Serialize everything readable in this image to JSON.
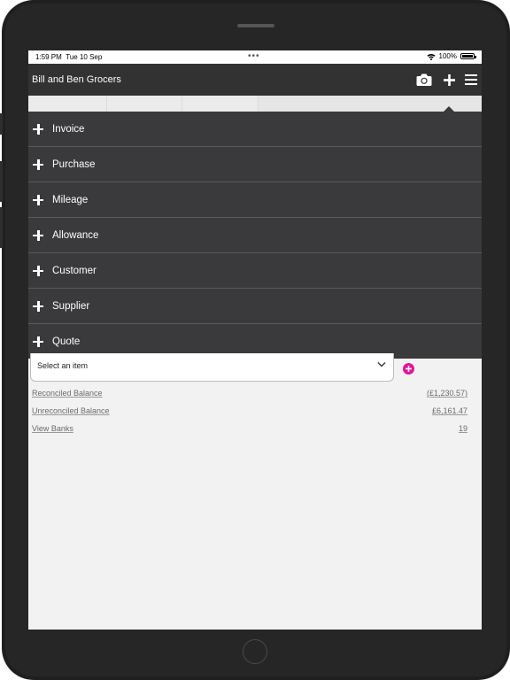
{
  "status_bar": {
    "time": "1:59 PM",
    "date": "Tue 10 Sep",
    "dots": "•••",
    "battery_text": "100%",
    "battery_level": 1.0
  },
  "app": {
    "title": "Bill and Ben Grocers",
    "icons": [
      "camera-icon",
      "plus-icon",
      "hamburger-menu-icon"
    ]
  },
  "menu": {
    "items": [
      {
        "label": "Invoice"
      },
      {
        "label": "Purchase"
      },
      {
        "label": "Mileage"
      },
      {
        "label": "Allowance"
      },
      {
        "label": "Customer"
      },
      {
        "label": "Supplier"
      },
      {
        "label": "Quote"
      }
    ]
  },
  "bank_select": {
    "value": "Select an item"
  },
  "balances": {
    "reconciled_label": "Reconciled Balance",
    "reconciled_value": "(£1,230.57)",
    "unreconciled_label": "Unreconciled Balance",
    "unreconciled_value": "£6,161.47",
    "view_banks_label": "View Banks",
    "view_banks_count": "19"
  },
  "colors": {
    "app_bar": "#323232",
    "menu_bg": "#3a3a3c",
    "accent": "#e0159c",
    "screen_bg": "#f2f2f2"
  }
}
